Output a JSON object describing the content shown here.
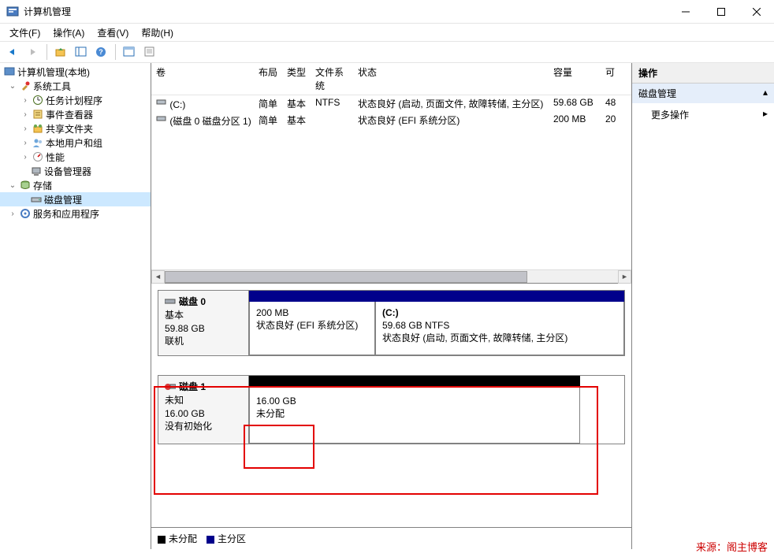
{
  "window": {
    "title": "计算机管理"
  },
  "menu": {
    "file": "文件(F)",
    "action": "操作(A)",
    "view": "查看(V)",
    "help": "帮助(H)"
  },
  "tree": {
    "root": "计算机管理(本地)",
    "systools": "系统工具",
    "scheduler": "任务计划程序",
    "events": "事件查看器",
    "shares": "共享文件夹",
    "users": "本地用户和组",
    "perf": "性能",
    "devmgr": "设备管理器",
    "storage": "存储",
    "diskmgmt": "磁盘管理",
    "services": "服务和应用程序"
  },
  "volHeaders": {
    "volume": "卷",
    "layout": "布局",
    "type": "类型",
    "fs": "文件系统",
    "status": "状态",
    "capacity": "容量",
    "free": "可"
  },
  "volumes": [
    {
      "name": "(C:)",
      "layout": "简单",
      "type": "基本",
      "fs": "NTFS",
      "status": "状态良好 (启动, 页面文件, 故障转储, 主分区)",
      "capacity": "59.68 GB",
      "free": "48"
    },
    {
      "name": "(磁盘 0 磁盘分区 1)",
      "layout": "简单",
      "type": "基本",
      "fs": "",
      "status": "状态良好 (EFI 系统分区)",
      "capacity": "200 MB",
      "free": "20"
    }
  ],
  "disk0": {
    "label": "磁盘 0",
    "type": "基本",
    "size": "59.88 GB",
    "state": "联机",
    "p0": {
      "size": "200 MB",
      "status": "状态良好 (EFI 系统分区)"
    },
    "p1": {
      "name": "(C:)",
      "fs": "59.68 GB NTFS",
      "status": "状态良好 (启动, 页面文件, 故障转储, 主分区)"
    }
  },
  "disk1": {
    "label": "磁盘 1",
    "type": "未知",
    "size": "16.00 GB",
    "state": "没有初始化",
    "p0": {
      "size": "16.00 GB",
      "status": "未分配"
    }
  },
  "legend": {
    "unalloc": "未分配",
    "primary": "主分区"
  },
  "actions": {
    "header": "操作",
    "sub": "磁盘管理",
    "more": "更多操作"
  },
  "watermark": "来源：阁主博客"
}
